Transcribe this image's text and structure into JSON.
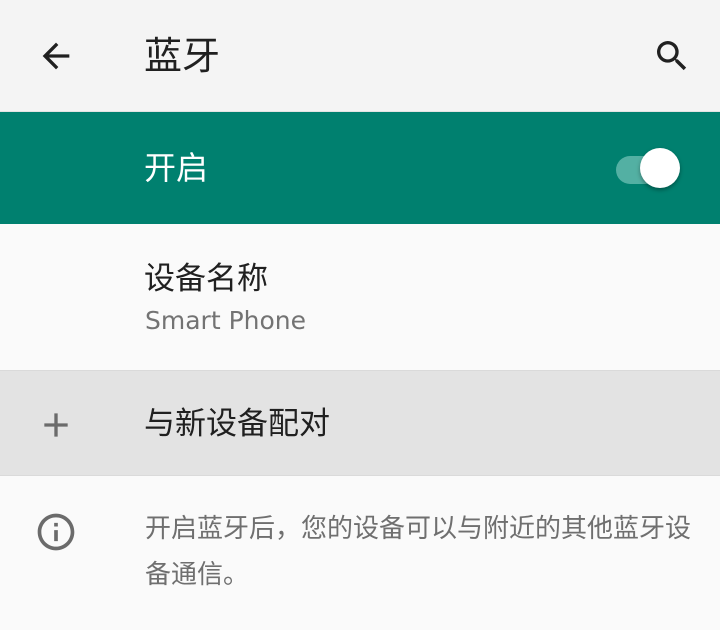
{
  "header": {
    "title": "蓝牙",
    "back_icon": "arrow-back-icon",
    "search_icon": "search-icon"
  },
  "master_switch": {
    "label": "开启",
    "state": "on",
    "accent_color": "#00806f"
  },
  "device_name": {
    "title": "设备名称",
    "value": "Smart Phone"
  },
  "pair_new": {
    "label": "与新设备配对",
    "icon": "plus-icon"
  },
  "info": {
    "icon": "info-icon",
    "text": "开启蓝牙后，您的设备可以与附近的其他蓝牙设备通信。"
  }
}
